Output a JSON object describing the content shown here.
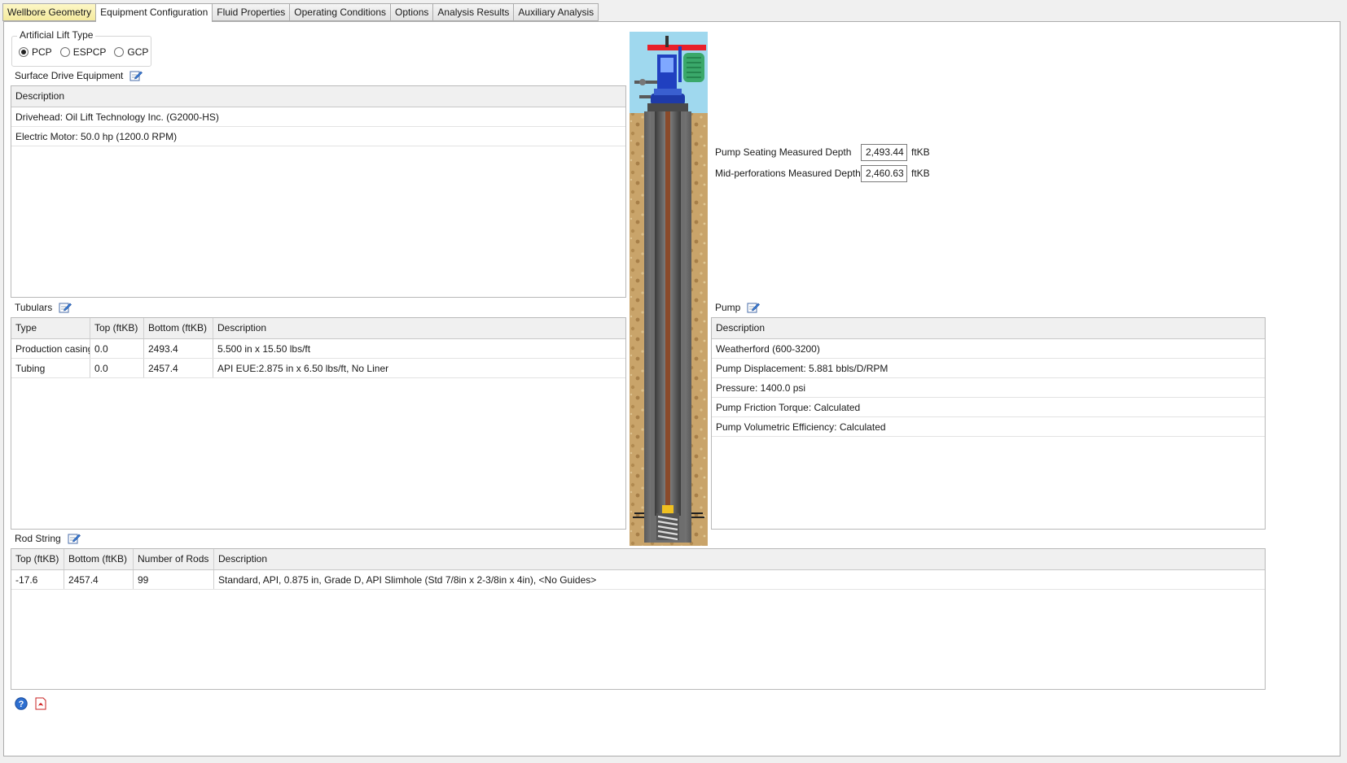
{
  "tabs": [
    {
      "label": "Wellbore Geometry"
    },
    {
      "label": "Equipment Configuration"
    },
    {
      "label": "Fluid Properties"
    },
    {
      "label": "Operating Conditions"
    },
    {
      "label": "Options"
    },
    {
      "label": "Analysis Results"
    },
    {
      "label": "Auxiliary Analysis"
    }
  ],
  "lift_type": {
    "legend": "Artificial Lift Type",
    "options": [
      "PCP",
      "ESPCP",
      "GCP"
    ],
    "selected": "PCP"
  },
  "surface_drive": {
    "title": "Surface Drive Equipment",
    "header": "Description",
    "rows": [
      "Drivehead: Oil Lift Technology Inc. (G2000-HS)",
      "Electric Motor: 50.0 hp (1200.0 RPM)"
    ]
  },
  "tubulars": {
    "title": "Tubulars",
    "columns": [
      "Type",
      "Top (ftKB)",
      "Bottom (ftKB)",
      "Description"
    ],
    "rows": [
      [
        "Production casing",
        "0.0",
        "2493.4",
        "5.500 in x 15.50 lbs/ft"
      ],
      [
        "Tubing",
        "0.0",
        "2457.4",
        "API EUE:2.875 in x 6.50 lbs/ft, No Liner"
      ]
    ]
  },
  "rod_string": {
    "title": "Rod String",
    "columns": [
      "Top (ftKB)",
      "Bottom (ftKB)",
      "Number of Rods",
      "Description"
    ],
    "rows": [
      [
        "-17.6",
        "2457.4",
        "99",
        "Standard, API, 0.875 in, Grade D, API Slimhole (Std 7/8in x 2-3/8in x 4in), <No Guides>"
      ]
    ]
  },
  "depths": {
    "pump_seating_label": "Pump Seating Measured Depth",
    "pump_seating_value": "2,493.44",
    "mid_perf_label": "Mid-perforations Measured Depth",
    "mid_perf_value": "2,460.63",
    "unit": "ftKB"
  },
  "pump": {
    "title": "Pump",
    "header": "Description",
    "rows": [
      "Weatherford (600-3200)",
      "Pump Displacement: 5.881 bbls/D/RPM",
      "Pressure: 1400.0 psi",
      "Pump Friction Torque: Calculated",
      "Pump Volumetric Efficiency: Calculated"
    ]
  },
  "colors": {
    "sky": "#9fd8ee",
    "soil": "#c9a46a",
    "rod": "#8a4a2a",
    "motor": "#3aa86a",
    "beam": "#e8202a",
    "drivehead": "#2040c0"
  },
  "icons": {
    "edit": "edit-icon",
    "help": "help-icon",
    "pdf": "pdf-icon"
  }
}
